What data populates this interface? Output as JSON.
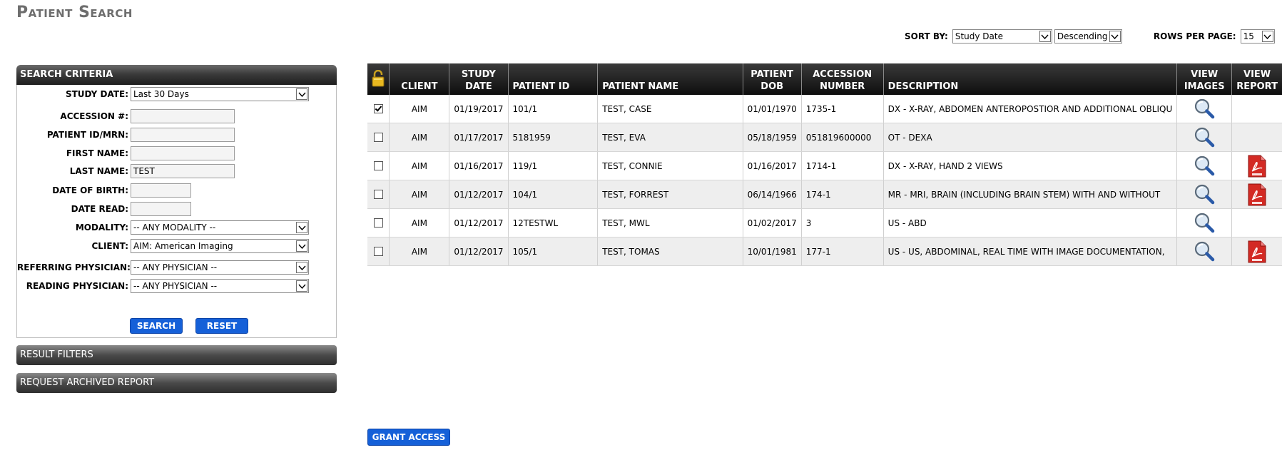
{
  "page_title": "Patient Search",
  "sort": {
    "sort_by_label": "SORT BY:",
    "sort_field": "Study Date",
    "sort_order": "Descending",
    "rows_label": "ROWS PER PAGE:",
    "rows_value": "15"
  },
  "search_criteria": {
    "title": "SEARCH CRITERIA",
    "study_date_label": "STUDY DATE:",
    "study_date_value": "Last 30 Days",
    "accession_label": "ACCESSION #:",
    "accession_value": "",
    "patient_id_label": "PATIENT ID/MRN:",
    "patient_id_value": "",
    "first_name_label": "FIRST NAME:",
    "first_name_value": "",
    "last_name_label": "LAST NAME:",
    "last_name_value": "TEST",
    "dob_label": "DATE OF BIRTH:",
    "dob_value": "",
    "date_read_label": "DATE READ:",
    "date_read_value": "",
    "modality_label": "MODALITY:",
    "modality_value": "-- ANY MODALITY --",
    "client_label": "CLIENT:",
    "client_value": "AIM: American Imaging",
    "referring_label": "REFERRING PHYSICIAN:",
    "referring_value": "-- ANY PHYSICIAN --",
    "reading_label": "READING PHYSICIAN:",
    "reading_value": "-- ANY PHYSICIAN --",
    "search_button": "SEARCH",
    "reset_button": "RESET"
  },
  "result_filters_label": "RESULT FILTERS",
  "archived_report_label": "REQUEST ARCHIVED REPORT",
  "grant_access_button": "GRANT ACCESS",
  "table": {
    "headers": {
      "client": "CLIENT",
      "study_date_1": "STUDY",
      "study_date_2": "DATE",
      "patient_id": "PATIENT ID",
      "patient_name": "PATIENT NAME",
      "dob_1": "PATIENT",
      "dob_2": "DOB",
      "accession_1": "ACCESSION",
      "accession_2": "NUMBER",
      "description": "DESCRIPTION",
      "view_images_1": "VIEW",
      "view_images_2": "IMAGES",
      "view_report_1": "VIEW",
      "view_report_2": "REPORT"
    },
    "rows": [
      {
        "checked": true,
        "client": "AIM",
        "study_date": "01/19/2017",
        "patient_id": "101/1",
        "patient_name": "TEST, CASE",
        "dob": "01/01/1970",
        "accession": "1735-1",
        "description": "DX - X-RAY, ABDOMEN ANTEROPOSTIOR AND ADDITIONAL OBLIQU",
        "report": false
      },
      {
        "checked": false,
        "client": "AIM",
        "study_date": "01/17/2017",
        "patient_id": "5181959",
        "patient_name": "TEST, EVA",
        "dob": "05/18/1959",
        "accession": "051819600000",
        "description": "OT - DEXA",
        "report": false
      },
      {
        "checked": false,
        "client": "AIM",
        "study_date": "01/16/2017",
        "patient_id": "119/1",
        "patient_name": "TEST, CONNIE",
        "dob": "01/16/2017",
        "accession": "1714-1",
        "description": "DX - X-RAY, HAND 2 VIEWS",
        "report": true
      },
      {
        "checked": false,
        "client": "AIM",
        "study_date": "01/12/2017",
        "patient_id": "104/1",
        "patient_name": "TEST, FORREST",
        "dob": "06/14/1966",
        "accession": "174-1",
        "description": "MR - MRI, BRAIN (INCLUDING BRAIN STEM) WITH AND WITHOUT",
        "report": true
      },
      {
        "checked": false,
        "client": "AIM",
        "study_date": "01/12/2017",
        "patient_id": "12TESTWL",
        "patient_name": "TEST, MWL",
        "dob": "01/02/2017",
        "accession": "3",
        "description": "US - ABD",
        "report": false
      },
      {
        "checked": false,
        "client": "AIM",
        "study_date": "01/12/2017",
        "patient_id": "105/1",
        "patient_name": "TEST, TOMAS",
        "dob": "10/01/1981",
        "accession": "177-1",
        "description": "US - US, ABDOMINAL, REAL TIME WITH IMAGE DOCUMENTATION,",
        "report": true
      }
    ]
  },
  "colors": {
    "button_blue": "#1560d8",
    "header_dark": "#1e1e1e",
    "row_alt": "#eeeeee"
  }
}
